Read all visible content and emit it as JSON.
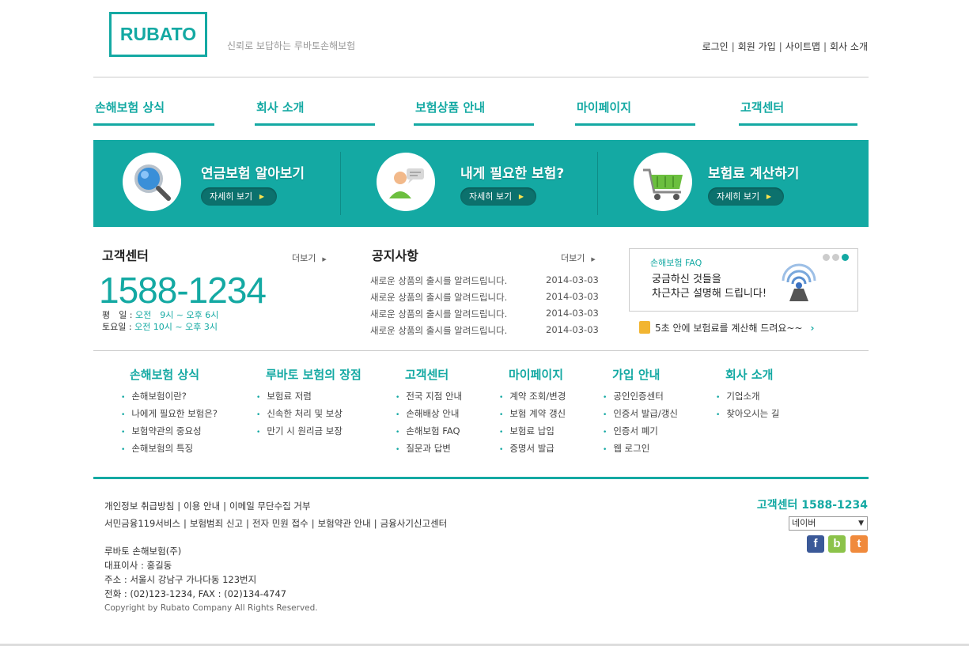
{
  "header": {
    "logo": "RUBATO",
    "tagline": "신뢰로 보답하는 루바토손해보험",
    "links": [
      "로그인",
      "회원 가입",
      "사이트맵",
      "회사 소개"
    ]
  },
  "main_nav": [
    "손해보험 상식",
    "회사 소개",
    "보험상품 안내",
    "마이페이지",
    "고객센터"
  ],
  "banner": {
    "items": [
      {
        "title": "연금보험 알아보기",
        "button": "자세히 보기",
        "icon": "magnifier-icon"
      },
      {
        "title": "내게 필요한 보험?",
        "button": "자세히 보기",
        "icon": "consultant-icon"
      },
      {
        "title": "보험료 계산하기",
        "button": "자세히 보기",
        "icon": "shopping-cart-icon"
      }
    ]
  },
  "customer_center": {
    "title": "고객센터",
    "more": "더보기",
    "phone": "1588-1234",
    "weekday_label": "평　일 : ",
    "weekday_hours": "오전　9시 ~ 오후 6시",
    "saturday_label": "토요일 : ",
    "saturday_hours": "오전 10시 ~ 오후 3시"
  },
  "notice": {
    "title": "공지사항",
    "more": "더보기",
    "rows": [
      {
        "text": "새로운 상품의 출시를 알려드립니다.",
        "date": "2014-03-03"
      },
      {
        "text": "새로운 상품의 출시를 알려드립니다.",
        "date": "2014-03-03"
      },
      {
        "text": "새로운 상품의 출시를 알려드립니다.",
        "date": "2014-03-03"
      },
      {
        "text": "새로운 상품의 출시를 알려드립니다.",
        "date": "2014-03-03"
      }
    ]
  },
  "faq": {
    "label": "손해보험 FAQ",
    "line1": "궁금하신 것들을",
    "line2": "차근차근 설명해 드립니다!",
    "calc": "5초 안에 보험료를 계산해 드려요~~"
  },
  "sitemap": [
    {
      "head": "손해보험 상식",
      "items": [
        "손해보험이란?",
        "나에게 필요한 보험은?",
        "보험약관의 중요성",
        "손해보험의 특징"
      ]
    },
    {
      "head": "루바토 보험의 장점",
      "items": [
        "보험료 저렴",
        "신속한 처리 및 보상",
        "만기 시 원리금 보장"
      ]
    },
    {
      "head": "고객센터",
      "items": [
        "전국 지점 안내",
        "손해배상 안내",
        "손해보험 FAQ",
        "질문과 답변"
      ]
    },
    {
      "head": "마이페이지",
      "items": [
        "계약 조회/변경",
        "보험 계약 갱신",
        "보험료 납입",
        "증명서 발급"
      ]
    },
    {
      "head": "가입 안내",
      "items": [
        "공인인증센터",
        "인증서 발급/갱신",
        "인증서 폐기",
        "웹 로그인"
      ]
    },
    {
      "head": "회사 소개",
      "items": [
        "기업소개",
        "찾아오시는 길"
      ]
    }
  ],
  "footer": {
    "links_row1": [
      "개인정보 취급방침",
      "이용 안내",
      "이메일 무단수집 거부"
    ],
    "links_row2": [
      "서민금융119서비스",
      "보험범죄 신고",
      "전자 민원 접수",
      "보험약관 안내",
      "금융사기신고센터"
    ],
    "company": "루바토 손해보험(주)",
    "ceo": "대표이사 : 홍길동",
    "address": "주소 : 서울시 강남구 가나다동 123번지",
    "tel": "전화 : (02)123-1234, FAX : (02)134-4747",
    "copyright": "Copyright by Rubato Company All Rights Reserved.",
    "center": "고객센터 1588-1234",
    "select_value": "네이버",
    "sns": [
      {
        "letter": "f",
        "color": "#3b5998",
        "icon": "facebook-icon"
      },
      {
        "letter": "b",
        "color": "#8cc34a",
        "icon": "blog-icon"
      },
      {
        "letter": "t",
        "color": "#f08a3c",
        "icon": "twitter-icon"
      }
    ]
  },
  "colors": {
    "accent": "#14a9a3",
    "banner_button": "#0c716d"
  }
}
